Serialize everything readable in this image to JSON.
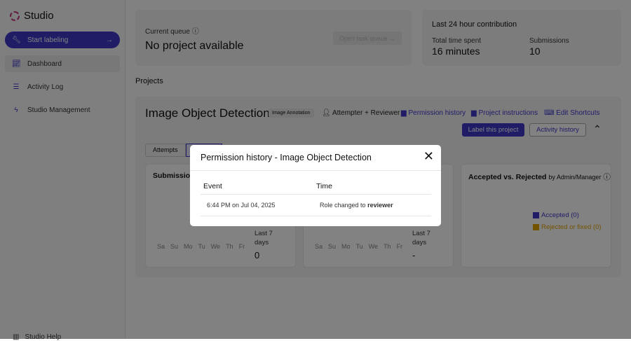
{
  "app": {
    "name": "Studio"
  },
  "sidebar": {
    "start": "Start labeling",
    "items": [
      "Dashboard",
      "Activity Log",
      "Studio Management"
    ],
    "help": "Studio Help"
  },
  "queue": {
    "label": "Current queue",
    "value": "No project available",
    "button": "Open task queue"
  },
  "contribution": {
    "title": "Last 24 hour contribution",
    "time_label": "Total time spent",
    "time_value": "16 minutes",
    "subs_label": "Submissions",
    "subs_value": "10"
  },
  "projects": {
    "heading": "Projects",
    "title": "Image Object Detection",
    "badge": "Image Annotation",
    "role": "Attempter + Reviewer",
    "links": [
      "Permission history",
      "Project instructions",
      "Edit Shortcuts"
    ],
    "label_btn": "Label this project",
    "activity_btn": "Activity history",
    "tabs": [
      "Attempts",
      ""
    ]
  },
  "charts": {
    "submissions_title": "Submissions",
    "days": [
      "Sa",
      "Su",
      "Mo",
      "Tu",
      "We",
      "Th",
      "Fr"
    ],
    "last7": "Last 7 days",
    "sub_value": "0",
    "second_value": "-",
    "accepted_title": "Accepted vs. Rejected",
    "accepted_by": "by Admin/Manager",
    "legend_accepted": "Accepted (0)",
    "legend_rejected": "Rejected or fixed (0)",
    "colors": {
      "accepted": "#3f37c9",
      "rejected": "#e0a400"
    }
  },
  "modal": {
    "title": "Permission history - Image Object Detection",
    "col_event": "Event",
    "col_time": "Time",
    "rows": [
      {
        "event": "6:44 PM on Jul 04, 2025",
        "time_prefix": "Role changed to ",
        "time_role": "reviewer"
      }
    ]
  }
}
